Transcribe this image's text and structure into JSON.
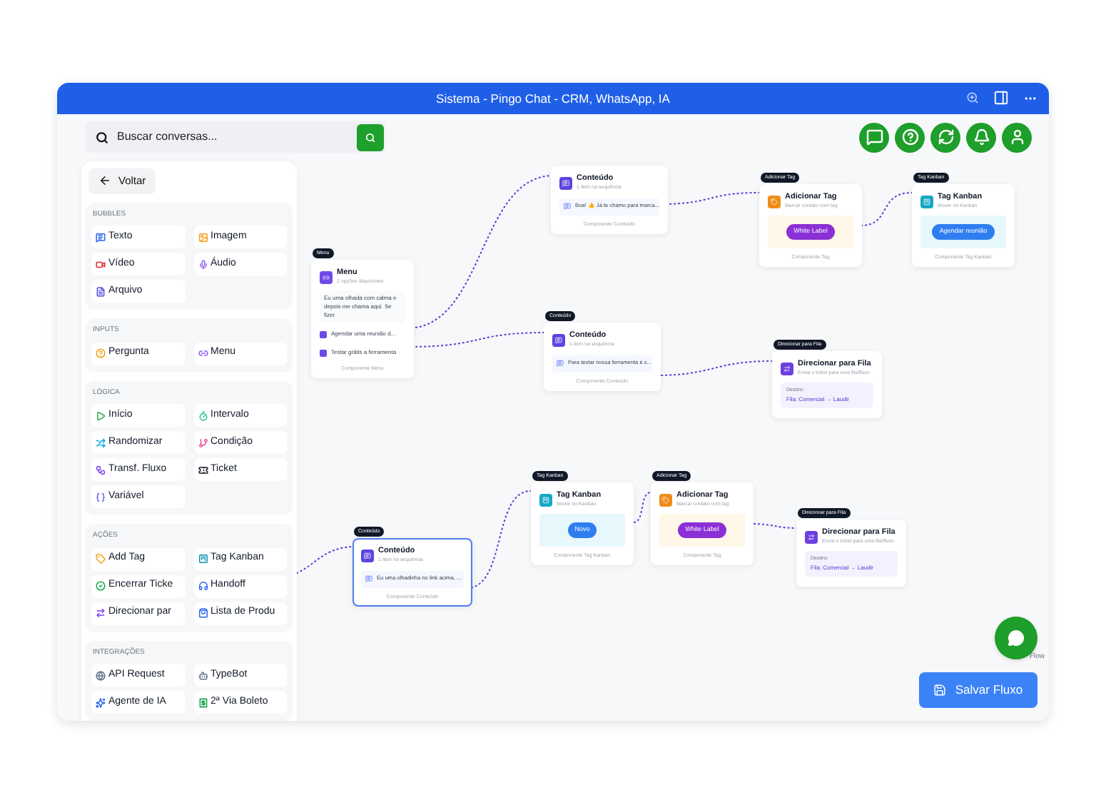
{
  "window": {
    "title": "Sistema - Pingo Chat - CRM, WhatsApp, IA"
  },
  "search": {
    "placeholder": "Buscar conversas..."
  },
  "sidebar": {
    "back": "Voltar",
    "sections": [
      {
        "title": "BUBBLES",
        "items": [
          "Texto",
          "Imagem",
          "Vídeo",
          "Áudio",
          "Arquivo"
        ]
      },
      {
        "title": "INPUTS",
        "items": [
          "Pergunta",
          "Menu"
        ]
      },
      {
        "title": "LÓGICA",
        "items": [
          "Início",
          "Intervalo",
          "Randomizar",
          "Condição",
          "Transf. Fluxo",
          "Ticket",
          "Variável"
        ]
      },
      {
        "title": "AÇÕES",
        "items": [
          "Add Tag",
          "Tag Kanban",
          "Encerrar Ticke",
          "Handoff",
          "Direcionar par",
          "Lista de Produ"
        ]
      },
      {
        "title": "INTEGRAÇÕES",
        "items": [
          "API Request",
          "TypeBot",
          "Agente de IA",
          "2ª Via Boleto"
        ]
      }
    ]
  },
  "nodes": [
    {
      "kind": "menu",
      "badge": "Menu",
      "title": "Menu",
      "subtitle": "2 opções disponíveis",
      "text": "Eu uma olhada com calma e depois me chama aqui. Se fizer",
      "options": [
        "Agendar uma reunião d...",
        "Testar grátis a ferramenta"
      ],
      "footer": "Componente Menu",
      "selected": false
    },
    {
      "kind": "content",
      "title": "Conteúdo",
      "subtitle": "1 item na sequência",
      "item": "Boa! 👍 Já te chamo para marca...",
      "footer": "Componente Conteúdo",
      "selected": false
    },
    {
      "kind": "tag",
      "badge": "Adicionar Tag",
      "title": "Adicionar Tag",
      "subtitle": "Marcar contato com tag",
      "pill": "White Label",
      "footer": "Componente Tag",
      "selected": false
    },
    {
      "kind": "kanban",
      "badge": "Tag Kanban",
      "title": "Tag Kanban",
      "subtitle": "Mover no Kanban",
      "pill": "Agendar reunião",
      "footer": "Componente Tag Kanban",
      "selected": false
    },
    {
      "kind": "content",
      "badge": "Conteúdo",
      "title": "Conteúdo",
      "subtitle": "1 item na sequência",
      "item": "Para testar nossa ferramenta é s...",
      "footer": "Componente Conteúdo",
      "selected": false
    },
    {
      "kind": "queue",
      "badge": "Direcionar para Fila",
      "title": "Direcionar para Fila",
      "subtitle": "Envia o ticket para uma fila/fluxo",
      "label": "Destino",
      "value": "Fila: Comercial → Laudir",
      "selected": false
    },
    {
      "kind": "content",
      "badge": "Conteúdo",
      "title": "Conteúdo",
      "subtitle": "1 item na sequência",
      "item": "Eu uma olhadinha no link acima, ...",
      "footer": "Componente Conteúdo",
      "selected": true
    },
    {
      "kind": "kanban",
      "badge": "Tag Kanban",
      "title": "Tag Kanban",
      "subtitle": "Mover no Kanban",
      "pill": "Novo",
      "footer": "Componente Tag Kanban",
      "selected": false
    },
    {
      "kind": "tag",
      "badge": "Adicionar Tag",
      "title": "Adicionar Tag",
      "subtitle": "Marcar contato com tag",
      "pill": "White Label",
      "footer": "Componente Tag",
      "selected": false
    },
    {
      "kind": "queue",
      "badge": "Direcionar para Fila",
      "title": "Direcionar para Fila",
      "subtitle": "Envia o ticket para uma fila/fluxo",
      "label": "Destino",
      "value": "Fila: Comercial → Laudir",
      "selected": false
    }
  ],
  "attribution": "Flow",
  "save_button": "Salvar Fluxo"
}
